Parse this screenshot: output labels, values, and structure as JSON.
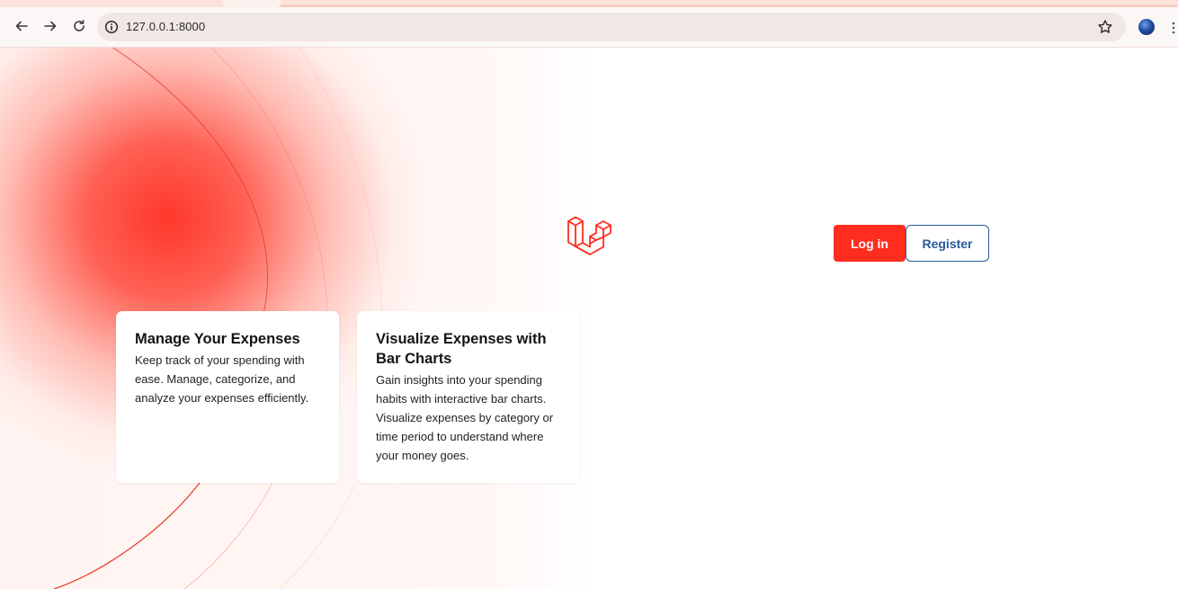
{
  "browser": {
    "url": "127.0.0.1:8000",
    "icons": {
      "back": "arrow-left-icon",
      "forward": "arrow-right-icon",
      "reload": "reload-icon",
      "site_info": "info-circle-icon",
      "bookmark": "star-icon",
      "profile": "globe-avatar-icon",
      "menu": "vertical-dots-icon"
    }
  },
  "brand": {
    "logo": "laravel-logo-icon",
    "accent_color": "#ff2d20"
  },
  "auth": {
    "login_label": "Log in",
    "register_label": "Register"
  },
  "features": [
    {
      "title": "Manage Your Expenses",
      "description": "Keep track of your spending with ease. Manage, categorize, and analyze your expenses efficiently."
    },
    {
      "title": "Visualize Expenses with Bar Charts",
      "description": "Gain insights into your spending habits with interactive bar charts. Visualize expenses by category or time period to understand where your money goes."
    }
  ]
}
